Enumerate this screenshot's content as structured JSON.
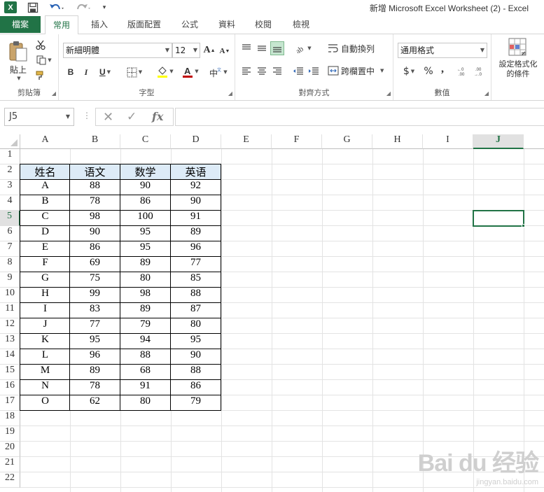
{
  "window": {
    "title": "新增 Microsoft Excel Worksheet (2) - Excel"
  },
  "qat": {
    "logo": "X",
    "customize": "▾"
  },
  "tabs": [
    {
      "label": "檔案"
    },
    {
      "label": "常用"
    },
    {
      "label": "插入"
    },
    {
      "label": "版面配置"
    },
    {
      "label": "公式"
    },
    {
      "label": "資料"
    },
    {
      "label": "校閱"
    },
    {
      "label": "檢視"
    }
  ],
  "ribbon": {
    "clipboard": {
      "label": "剪貼簿",
      "paste_label": "貼上"
    },
    "font": {
      "label": "字型",
      "font_name": "新細明體",
      "font_size": "12",
      "bold": "B",
      "italic": "I",
      "underline": "U",
      "grow": "A",
      "shrink": "A"
    },
    "alignment": {
      "label": "對齊方式",
      "wrap_text": "自動換列",
      "merge_center": "跨欄置中"
    },
    "number": {
      "label": "數值",
      "format": "通用格式",
      "currency": "$",
      "percent": "%",
      "comma": ","
    },
    "styles": {
      "conditional_formatting": "設定格式化的條件"
    }
  },
  "formula_bar": {
    "name_box": "J5",
    "formula": ""
  },
  "grid": {
    "columns": [
      "A",
      "B",
      "C",
      "D",
      "E",
      "F",
      "G",
      "H",
      "I",
      "J"
    ],
    "selected_column": "J",
    "row_numbers": [
      "1",
      "2",
      "3",
      "4",
      "5",
      "6",
      "7",
      "8",
      "9",
      "10",
      "11",
      "12",
      "13",
      "14",
      "15",
      "16",
      "17",
      "18",
      "19",
      "20",
      "21",
      "22"
    ],
    "selected_row": "5",
    "table": {
      "headers": [
        "姓名",
        "语文",
        "数学",
        "英语"
      ],
      "rows": [
        [
          "A",
          "88",
          "90",
          "92"
        ],
        [
          "B",
          "78",
          "86",
          "90"
        ],
        [
          "C",
          "98",
          "100",
          "91"
        ],
        [
          "D",
          "90",
          "95",
          "89"
        ],
        [
          "E",
          "86",
          "95",
          "96"
        ],
        [
          "F",
          "69",
          "89",
          "77"
        ],
        [
          "G",
          "75",
          "80",
          "85"
        ],
        [
          "H",
          "99",
          "98",
          "88"
        ],
        [
          "I",
          "83",
          "89",
          "87"
        ],
        [
          "J",
          "77",
          "79",
          "80"
        ],
        [
          "K",
          "95",
          "94",
          "95"
        ],
        [
          "L",
          "96",
          "88",
          "90"
        ],
        [
          "M",
          "89",
          "68",
          "88"
        ],
        [
          "N",
          "78",
          "91",
          "86"
        ],
        [
          "O",
          "62",
          "80",
          "79"
        ]
      ]
    }
  },
  "watermark": {
    "brand": "Bai du 经验",
    "url": "jingyan.baidu.com"
  },
  "colors": {
    "accent": "#217346",
    "header_fill": "#ddebf7",
    "gridline": "#e3e3e3"
  }
}
